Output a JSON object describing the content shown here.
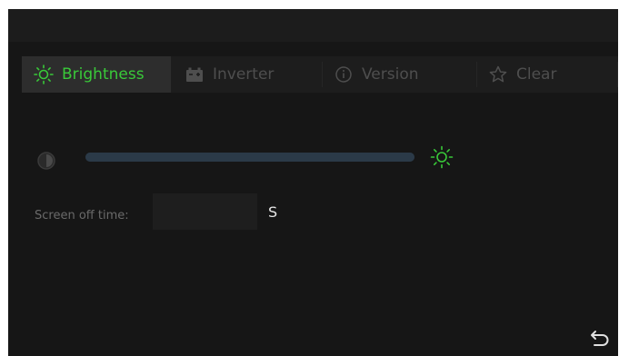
{
  "tabs": [
    {
      "label": "Brightness",
      "icon": "sun-icon",
      "active": true
    },
    {
      "label": "Inverter",
      "icon": "battery-icon",
      "active": false
    },
    {
      "label": "Version",
      "icon": "info-icon",
      "active": false
    },
    {
      "label": "Clear",
      "icon": "star-icon",
      "active": false
    }
  ],
  "brightness": {
    "level": 1.0
  },
  "screen_off": {
    "label": "Screen off time:",
    "value": "",
    "unit": "S"
  },
  "colors": {
    "accent": "#39c939",
    "background": "#161616",
    "tab_inactive_text": "#4e4e4e",
    "slider_track": "#262f3a"
  }
}
